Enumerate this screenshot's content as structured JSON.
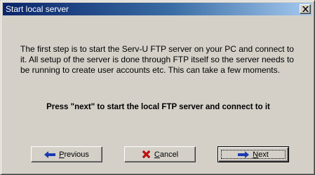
{
  "window": {
    "title": "Start local server",
    "close_icon": "close-x-icon"
  },
  "message": {
    "body": "The first step is to start the Serv-U FTP server on your PC and connect to it. All setup of the server is done through FTP itself so the server needs to be running to create user accounts etc. This can take a few moments.",
    "instruction": "Press \"next\" to start the local FTP server and connect to it"
  },
  "buttons": {
    "previous": {
      "label": "Previous",
      "icon": "arrow-left-icon"
    },
    "cancel": {
      "label": "Cancel",
      "icon": "red-x-icon"
    },
    "next": {
      "label": "Next",
      "icon": "arrow-right-icon"
    }
  },
  "colors": {
    "titlebar_start": "#0a246a",
    "titlebar_end": "#a6caf0",
    "face": "#d4d0c8",
    "arrow_blue": "#1a3bb0",
    "cancel_red": "#cc1111"
  }
}
